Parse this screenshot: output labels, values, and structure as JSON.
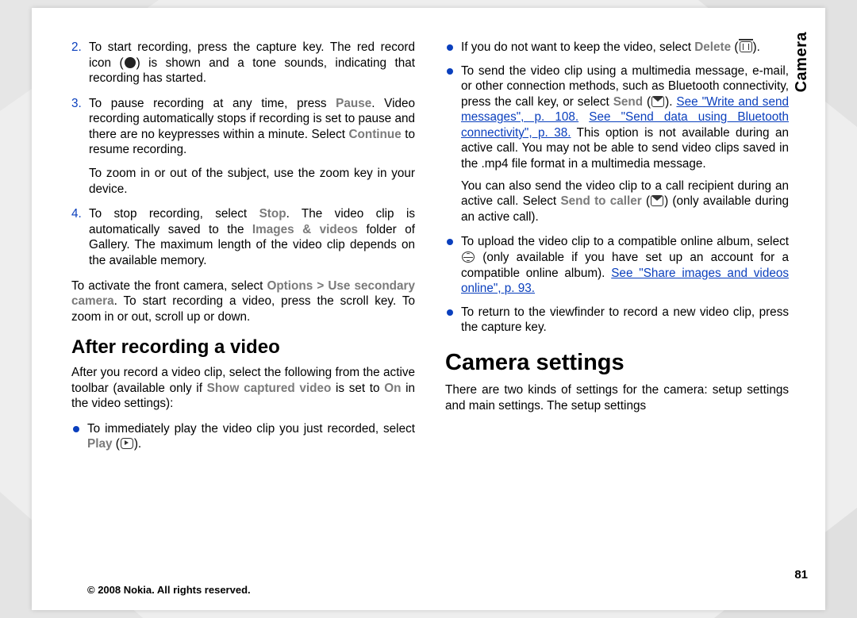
{
  "sideTab": "Camera",
  "pageNumber": "81",
  "footer": "© 2008 Nokia. All rights reserved.",
  "leftCol": {
    "step2": {
      "num": "2.",
      "text_a": "To start recording, press the capture key. The red record icon (",
      "text_b": ") is shown and a tone sounds, indicating that recording has started."
    },
    "step3": {
      "num": "3.",
      "pre": "To pause recording at any time, press ",
      "pause": "Pause",
      "post_a": ". Video recording automatically stops if recording is set to pause and there are no keypresses within a minute. Select ",
      "cont": "Continue",
      "post_b": " to resume recording."
    },
    "zoom": "To zoom in or out of the subject, use the zoom key in your device.",
    "step4": {
      "num": "4.",
      "pre": "To stop recording, select ",
      "stop": "Stop",
      "mid": ". The video clip is automatically saved to the ",
      "iv": "Images & videos",
      "post": " folder of Gallery. The maximum length of the video clip depends on the available memory."
    },
    "front": {
      "pre": "To activate the front camera, select ",
      "opt": "Options",
      "arrow": ">",
      "use": "Use secondary camera",
      "post": ". To start recording a video, press the scroll key. To zoom in or out, scroll up or down."
    },
    "h_after": "After recording a video",
    "after_para": {
      "pre": "After you record a video clip, select the following from the active toolbar (available only if ",
      "sv": "Show captured video",
      "mid": " is set to ",
      "on": "On",
      "post": " in the video settings):"
    },
    "bullet_play": {
      "pre": "To immediately play the video clip you just recorded, select ",
      "play": "Play",
      "post": " (",
      "post2": ")."
    }
  },
  "rightCol": {
    "bullet_del": {
      "pre": "If you do not want to keep the video, select ",
      "del": "Delete",
      "post": " (",
      "post2": ")."
    },
    "bullet_send": {
      "pre": "To send the video clip using a multimedia message, e-mail, or other connection methods, such as Bluetooth connectivity, press the call key, or select ",
      "send": "Send",
      "paren": " (",
      "link1": "See \"Write and send messages\", p. 108.",
      "link2": "See \"Send data using Bluetooth connectivity\", p. 38.",
      "tail": " This option is not available during an active call. You may not be able to send video clips saved in the .mp4 file format in a multimedia message."
    },
    "send_continued": {
      "pre": "You can also send the video clip to a call recipient during an active call. Select ",
      "stc": "Send to caller",
      "post": " (",
      "post2": ") (only available during an active call)."
    },
    "bullet_upload": {
      "pre": "To upload the video clip to a compatible online album, select ",
      "mid": " (only available if you have set up an account for a compatible online album). ",
      "link": "See \"Share images and videos online\", p. 93."
    },
    "bullet_return": "To return to the viewfinder to record a new video clip, press the capture key.",
    "h_settings": "Camera settings",
    "settings_para": "There are two kinds of settings for the camera: setup settings and main settings. The setup settings"
  }
}
